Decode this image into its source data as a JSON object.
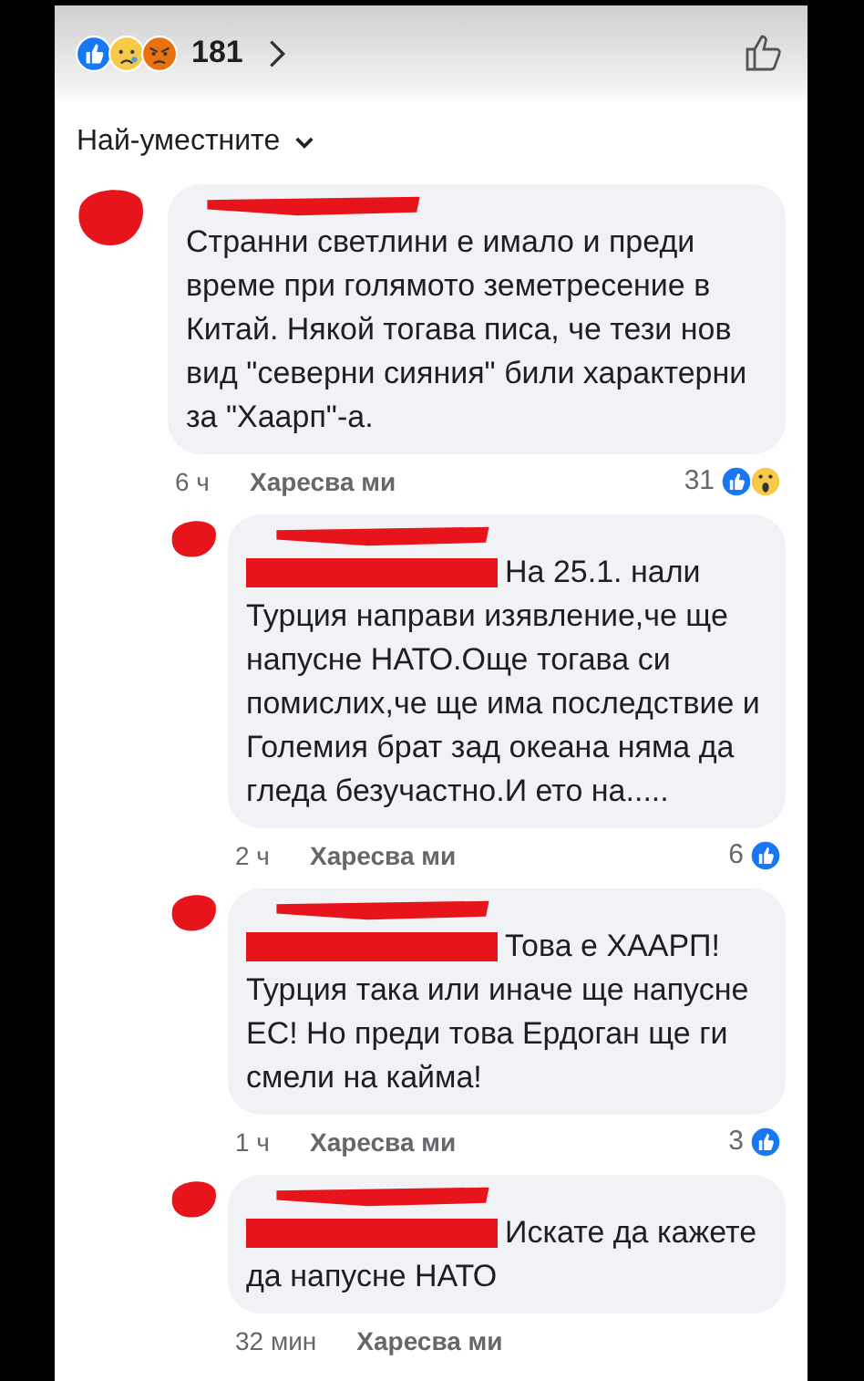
{
  "post_reactions": {
    "kinds": [
      {
        "kind": "like"
      },
      {
        "kind": "sad"
      },
      {
        "kind": "angry"
      }
    ],
    "count": "181"
  },
  "sort": {
    "label": "Най-уместните"
  },
  "comments": [
    {
      "text": "Странни светлини е имало и преди време при голямото земетресение в Китай. Някой тогава писа, че тези нов вид \"северни сияния\" били характерни за \"Хаарп\"-а.",
      "time": "6 ч",
      "like_label": "Харесва ми",
      "reaction_count": "31",
      "reactions": [
        {
          "kind": "like"
        },
        {
          "kind": "wow"
        }
      ],
      "children": [
        {
          "text": "На 25.1. нали Турция направи изявление,че ще напусне НАТО.Още тогава си помислих,че ще има последствие и Големия брат зад океана няма да гледа безучастно.И ето на.....",
          "time": "2 ч",
          "like_label": "Харесва ми",
          "reaction_count": "6",
          "reactions": [
            {
              "kind": "like"
            }
          ]
        },
        {
          "text": "Това е ХААРП! Турция така или иначе ще напусне ЕС! Но преди това Ердоган ще ги смели на кайма!",
          "time": "1 ч",
          "like_label": "Харесва ми",
          "reaction_count": "3",
          "reactions": [
            {
              "kind": "like"
            }
          ]
        },
        {
          "text": "Искате да кажете да напусне НАТО",
          "time": "32 мин",
          "like_label": "Харесва ми"
        }
      ]
    }
  ]
}
